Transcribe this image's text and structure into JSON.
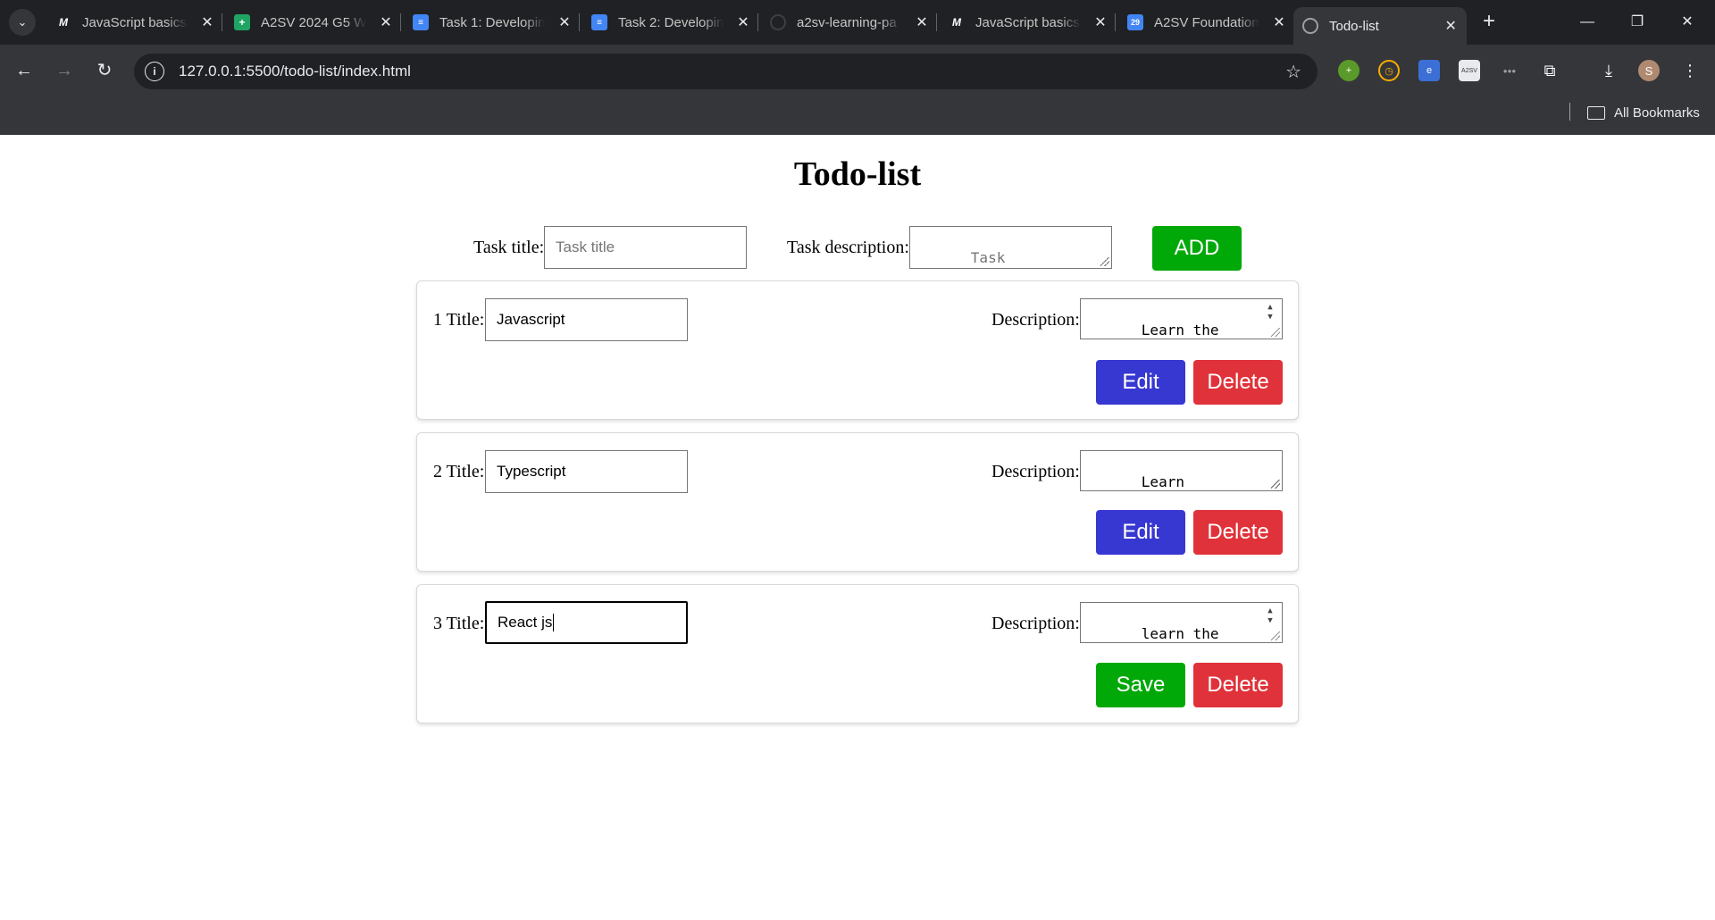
{
  "browser": {
    "tabs": [
      {
        "label": "JavaScript basics",
        "icon": "medium-icon",
        "left": 0
      },
      {
        "label": "A2SV 2024 G5 W",
        "icon": "sheets-icon"
      },
      {
        "label": "Task 1: Developin",
        "icon": "docs-icon"
      },
      {
        "label": "Task 2: Developin",
        "icon": "docs-icon"
      },
      {
        "label": "a2sv-learning-pa",
        "icon": "github-icon"
      },
      {
        "label": "JavaScript basics",
        "icon": "medium-icon"
      },
      {
        "label": "A2SV Foundation",
        "icon": "calendar-icon"
      },
      {
        "label": "Todo-list",
        "icon": "globe-icon",
        "active": true
      }
    ],
    "url": "127.0.0.1:5500/todo-list/index.html",
    "bookmarks_label": "All Bookmarks",
    "profile_initial": "S",
    "calendar_day": "29"
  },
  "page": {
    "title": "Todo-list",
    "form": {
      "title_label": "Task title:",
      "title_placeholder": "Task title",
      "description_label": "Task description:",
      "description_placeholder": "Task description...",
      "add_label": "ADD"
    },
    "tasks": [
      {
        "number": "1",
        "title_label": "Title:",
        "title_value": "Javascript",
        "description_label": "Description:",
        "description_value": "Learn the basics of\njavascript",
        "primary_label": "Edit",
        "delete_label": "Delete"
      },
      {
        "number": "2",
        "title_label": "Title:",
        "title_value": "Typescript",
        "description_label": "Description:",
        "description_value": "Learn Typescript",
        "primary_label": "Edit",
        "delete_label": "Delete"
      },
      {
        "number": "3",
        "title_label": "Title:",
        "title_value": "React js",
        "description_label": "Description:",
        "description_value": "learn the basics of\nreact js",
        "primary_label": "Save",
        "delete_label": "Delete"
      }
    ]
  },
  "colors": {
    "add_button": "#00a808",
    "edit_button": "#3737d2",
    "save_button": "#00a808",
    "delete_button": "#e0323a"
  }
}
